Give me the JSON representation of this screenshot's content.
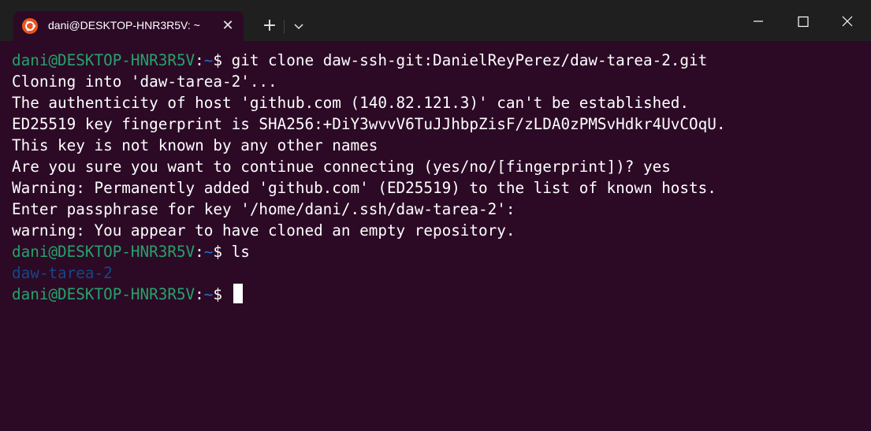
{
  "tab": {
    "title": "dani@DESKTOP-HNR3R5V: ~",
    "close_glyph": "✕",
    "icon": "ubuntu-icon"
  },
  "toolbar": {
    "new_tab_glyph": "+",
    "dropdown_icon": "chevron-down-icon"
  },
  "window_controls": [
    "minimize-icon",
    "maximize-icon",
    "close-icon"
  ],
  "prompt": {
    "user_host": "dani@DESKTOP-HNR3R5V",
    "colon": ":",
    "path": "~",
    "symbol": "$ "
  },
  "terminal": {
    "commands": [
      "git clone daw-ssh-git:DanielReyPerez/daw-tarea-2.git",
      "ls",
      ""
    ],
    "output": [
      "Cloning into 'daw-tarea-2'...",
      "The authenticity of host 'github.com (140.82.121.3)' can't be established.",
      "ED25519 key fingerprint is SHA256:+DiY3wvvV6TuJJhbpZisF/zLDA0zPMSvHdkr4UvCOqU.",
      "This key is not known by any other names",
      "Are you sure you want to continue connecting (yes/no/[fingerprint])? yes",
      "Warning: Permanently added 'github.com' (ED25519) to the list of known hosts.",
      "Enter passphrase for key '/home/dani/.ssh/daw-tarea-2':",
      "warning: You appear to have cloned an empty repository."
    ],
    "ls_result": "daw-tarea-2"
  },
  "colors": {
    "background": "#2c0a26",
    "titlebar": "#1f1f1f",
    "prompt_user": "#26a269",
    "prompt_path": "#12488b",
    "accent": "#e95420"
  }
}
